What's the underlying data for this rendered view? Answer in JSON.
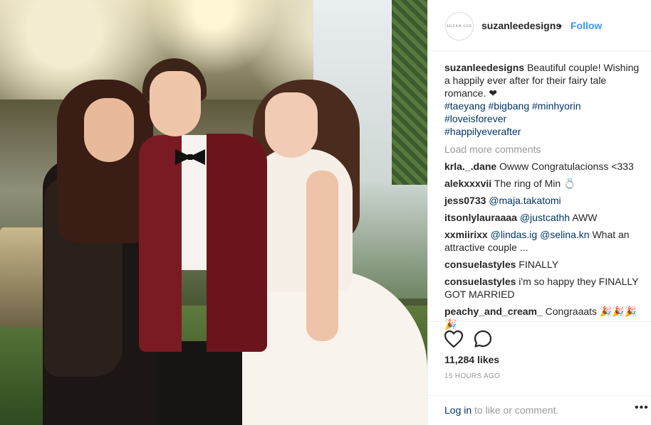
{
  "header": {
    "avatar_text": "SUZAN LEE",
    "username": "suzanleedesigns",
    "separator": "•",
    "follow_label": "Follow"
  },
  "caption": {
    "username": "suzanleedesigns",
    "text": "Beautiful couple! Wishing a happily ever after for their fairy tale romance. ❤",
    "hashtags": [
      "#taeyang",
      "#bigbang",
      "#minhyorin",
      "#loveisforever",
      "#happilyeverafter"
    ]
  },
  "load_more_label": "Load more comments",
  "comments": [
    {
      "user": "krla._.dane",
      "text": "Owww Congratulacionss <333"
    },
    {
      "user": "alekxxxvii",
      "text": "The ring of Min 💍"
    },
    {
      "user": "jess0733",
      "text": "",
      "mention": "@maja.takatomi"
    },
    {
      "user": "itsonlylauraaaa",
      "text": "AWW",
      "mention": "@justcathh"
    },
    {
      "user": "xxmiirixx",
      "text": "What an attractive couple ...",
      "mention": "@lindas.ig",
      "mention2": "@selina.kn"
    },
    {
      "user": "consuelastyles",
      "text": "FINALLY"
    },
    {
      "user": "consuelastyles",
      "text": "i'm so happy they FINALLY GOT MARRIED"
    },
    {
      "user": "peachy_and_cream_",
      "text": "Congraaats 🎉🎉🎉🎉"
    }
  ],
  "actions": {
    "like_icon": "heart-icon",
    "comment_icon": "comment-bubble-icon",
    "likes": "11,284 likes",
    "timestamp": "15 HOURS AGO"
  },
  "footer": {
    "login_link": "Log in",
    "login_rest": " to like or comment.",
    "more_icon": "•••"
  },
  "colors": {
    "link_blue": "#3897f0",
    "hashtag": "#003569",
    "muted": "#999999",
    "text": "#262626",
    "border": "#efefef"
  }
}
